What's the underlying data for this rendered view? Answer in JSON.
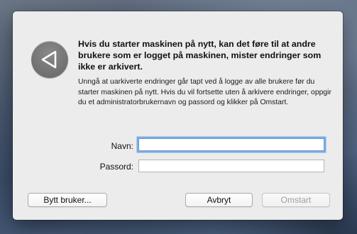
{
  "dialog": {
    "title": "Hvis du starter maskinen på nytt, kan det føre til at andre brukere som er logget på maskinen, mister endringer som ikke er arkivert.",
    "message": "Unngå at uarkiverte endringer går tapt ved å logge av alle brukere før du starter maskinen på nytt. Hvis du vil fortsette uten å arkivere endringer, oppgir du et administratorbrukernavn og passord og klikker på Omstart.",
    "icon": "restart-warning-icon"
  },
  "form": {
    "name_label": "Navn:",
    "name_value": "",
    "password_label": "Passord:",
    "password_value": ""
  },
  "buttons": {
    "switch_user": "Bytt bruker...",
    "cancel": "Avbryt",
    "restart": "Omstart",
    "restart_enabled": false
  },
  "colors": {
    "dialog_bg": "#ececec",
    "focus_ring": "#5796e1",
    "icon_gray": "#757575",
    "disabled_text": "#9d9d9d"
  }
}
